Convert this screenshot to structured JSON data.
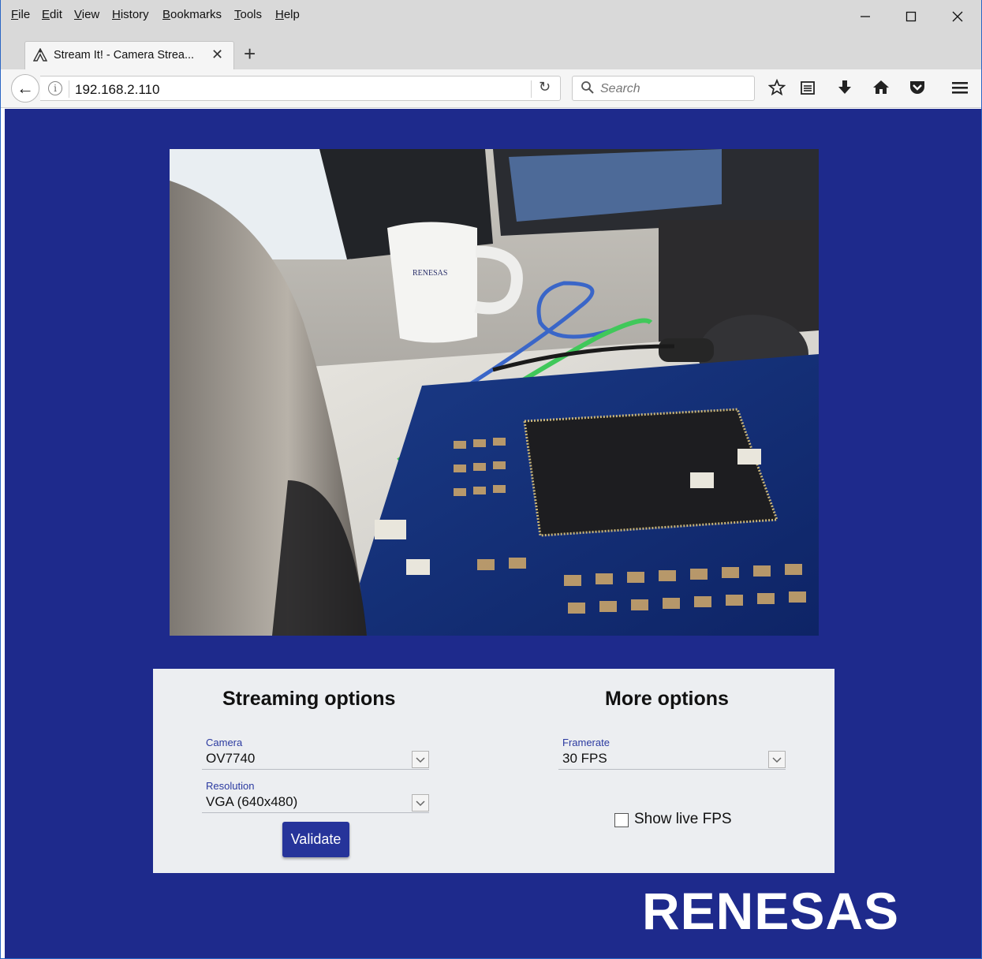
{
  "menubar": {
    "items": [
      "File",
      "Edit",
      "View",
      "History",
      "Bookmarks",
      "Tools",
      "Help"
    ]
  },
  "window_controls": {
    "minimize_icon": "minimize-icon",
    "maximize_icon": "maximize-icon",
    "close_icon": "close-icon"
  },
  "tab": {
    "title": "Stream It! - Camera Strea...",
    "favicon": "renesas-favicon",
    "close_glyph": "✕",
    "new_tab_glyph": "+"
  },
  "navbar": {
    "url": "192.168.2.110",
    "search_placeholder": "Search",
    "info_glyph": "i",
    "reload_glyph": "↻",
    "back_glyph": "←"
  },
  "toolbar_icons": [
    "star-icon",
    "reading-list-icon",
    "download-icon",
    "home-icon",
    "pocket-icon",
    "hamburger-menu-icon"
  ],
  "main": {
    "background_color": "#1e2a8c",
    "camera_view_description": "live-camera-feed-image"
  },
  "streaming_options": {
    "heading": "Streaming options",
    "camera_label": "Camera",
    "camera_value": "OV7740",
    "resolution_label": "Resolution",
    "resolution_value": "VGA (640x480)",
    "validate_label": "Validate"
  },
  "more_options": {
    "heading": "More options",
    "framerate_label": "Framerate",
    "framerate_value": "30 FPS",
    "show_fps_label": "Show live FPS",
    "show_fps_checked": false
  },
  "brand": {
    "logo_text": "RENESAS",
    "accent_color": "#26349a",
    "panel_color": "#eceef1"
  }
}
